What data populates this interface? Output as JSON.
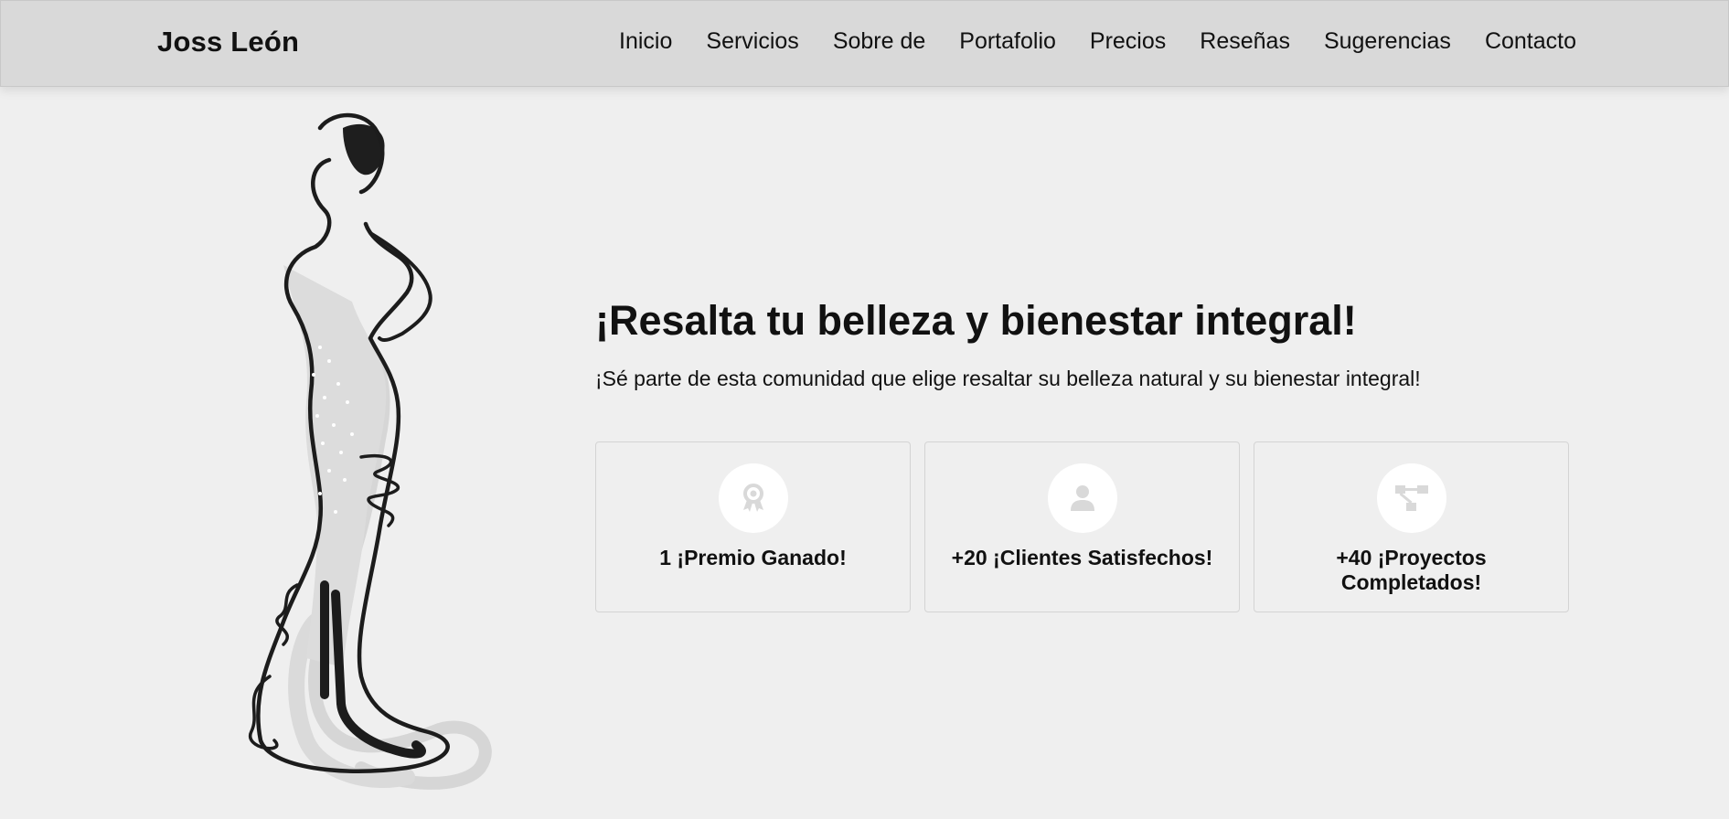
{
  "header": {
    "brand": "Joss León",
    "nav": [
      "Inicio",
      "Servicios",
      "Sobre de",
      "Portafolio",
      "Precios",
      "Reseñas",
      "Sugerencias",
      "Contacto"
    ]
  },
  "hero": {
    "title": "¡Resalta tu belleza y bienestar integral!",
    "subtitle": "¡Sé parte de esta comunidad que elige resaltar su belleza natural y su bienestar integral!",
    "illustration_icon": "woman-in-gown-illustration"
  },
  "stats": [
    {
      "icon": "award-ribbon-icon",
      "label": "1 ¡Premio Ganado!"
    },
    {
      "icon": "user-icon",
      "label": "+20 ¡Clientes Satisfechos!"
    },
    {
      "icon": "project-diagram-icon",
      "label": "+40 ¡Proyectos Completados!"
    }
  ],
  "colors": {
    "header_bg": "#d9d9d9",
    "page_bg": "#efefef",
    "icon_circle": "#ffffff",
    "icon_glyph": "#dcdcdc"
  }
}
